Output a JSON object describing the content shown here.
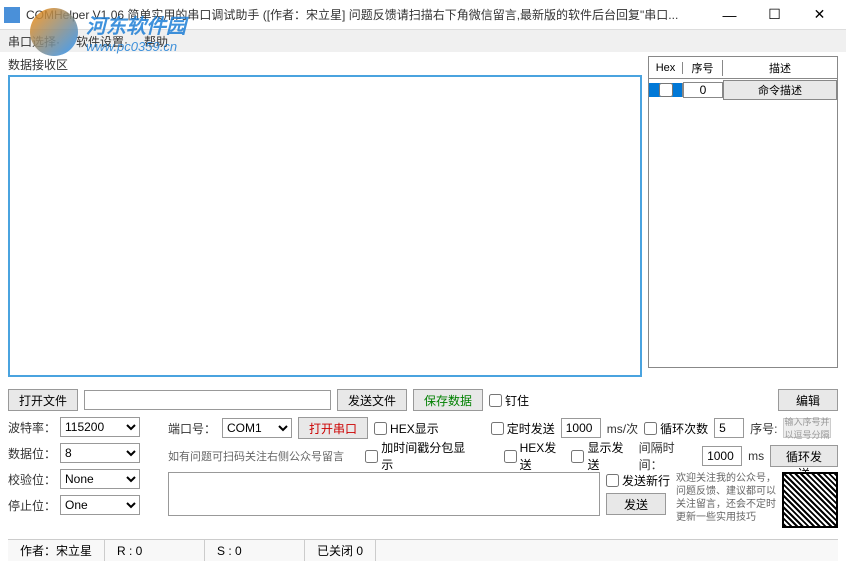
{
  "window": {
    "title": "COMHelper V1.06 简单实用的串口调试助手  ([作者：宋立星] 问题反馈请扫描右下角微信留言,最新版的软件后台回复\"串口...",
    "min": "—",
    "max": "☐",
    "close": "✕"
  },
  "menu": {
    "port_select": "串口选择·",
    "soft_settings": "软件设置·",
    "help": "帮助"
  },
  "watermark": {
    "line1": "河东软件园",
    "line2": "www.pc0359.cn"
  },
  "recv": {
    "label": "数据接收区"
  },
  "cmd_table": {
    "hex": "Hex",
    "num": "序号",
    "desc": "描述",
    "row0_num": "0",
    "row0_desc": "命令描述"
  },
  "file_row": {
    "open": "打开文件",
    "send_file": "发送文件",
    "save_data": "保存数据",
    "pin": "钉住",
    "edit": "编辑"
  },
  "settings": {
    "baud_label": "波特率：",
    "baud_value": "115200",
    "data_label": "数据位：",
    "data_value": "8",
    "parity_label": "校验位：",
    "parity_value": "None",
    "stop_label": "停止位：",
    "stop_value": "One",
    "port_label": "端口号：",
    "port_value": "COM1",
    "open_port": "打开串口",
    "hint": "如有问题可扫码关注右侧公众号留言"
  },
  "send_opts": {
    "hex_display": "HEX显示",
    "add_timestamp": "加时间戳分包显示",
    "timed_send": "定时发送",
    "timed_value": "1000",
    "timed_unit": "ms/次",
    "hex_send": "HEX发送",
    "show_send": "显示发送",
    "send_newline": "发送新行",
    "send_btn": "发送"
  },
  "loop": {
    "count_label": "循环次数",
    "count_value": "5",
    "seq_label": "序号:",
    "seq_hint": "输入序号并以逗号分隔",
    "interval_label": "间隔时间：",
    "interval_value": "1000",
    "interval_unit": "ms",
    "loop_send": "循环发送"
  },
  "pub": {
    "text": "欢迎关注我的公众号，问题反馈、建议都可以关注留言，还会不定时更新一些实用技巧"
  },
  "status": {
    "author": "作者：宋立星",
    "rx": "R : 0",
    "tx": "S : 0",
    "state": "已关闭 0"
  }
}
